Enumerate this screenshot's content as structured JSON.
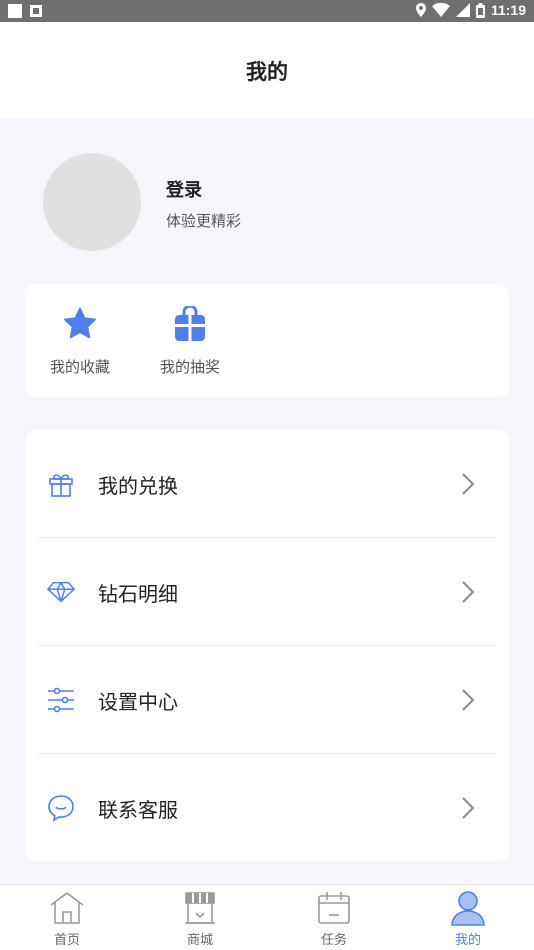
{
  "status_bar": {
    "time": "11:19",
    "icons": [
      "square-icon",
      "image-icon",
      "location-icon",
      "wifi-icon",
      "signal-icon",
      "battery-icon"
    ]
  },
  "header": {
    "title": "我的"
  },
  "profile": {
    "login_label": "登录",
    "subtitle": "体验更精彩"
  },
  "quick_actions": [
    {
      "label": "我的收藏",
      "icon": "star-icon"
    },
    {
      "label": "我的抽奖",
      "icon": "gift-bag-icon"
    }
  ],
  "menu": [
    {
      "label": "我的兑换",
      "icon": "gift-box-icon"
    },
    {
      "label": "钻石明细",
      "icon": "diamond-icon"
    },
    {
      "label": "设置中心",
      "icon": "sliders-icon"
    },
    {
      "label": "联系客服",
      "icon": "chat-bubble-icon"
    }
  ],
  "tabbar": [
    {
      "label": "首页",
      "icon": "home-icon",
      "active": false
    },
    {
      "label": "商城",
      "icon": "shop-icon",
      "active": false
    },
    {
      "label": "任务",
      "icon": "calendar-icon",
      "active": false
    },
    {
      "label": "我的",
      "icon": "user-icon",
      "active": true
    }
  ],
  "colors": {
    "accent": "#4f7fe8",
    "page_background": "#f4f6fb",
    "card_background": "#ffffff",
    "status_bar": "#6f6f6f"
  }
}
